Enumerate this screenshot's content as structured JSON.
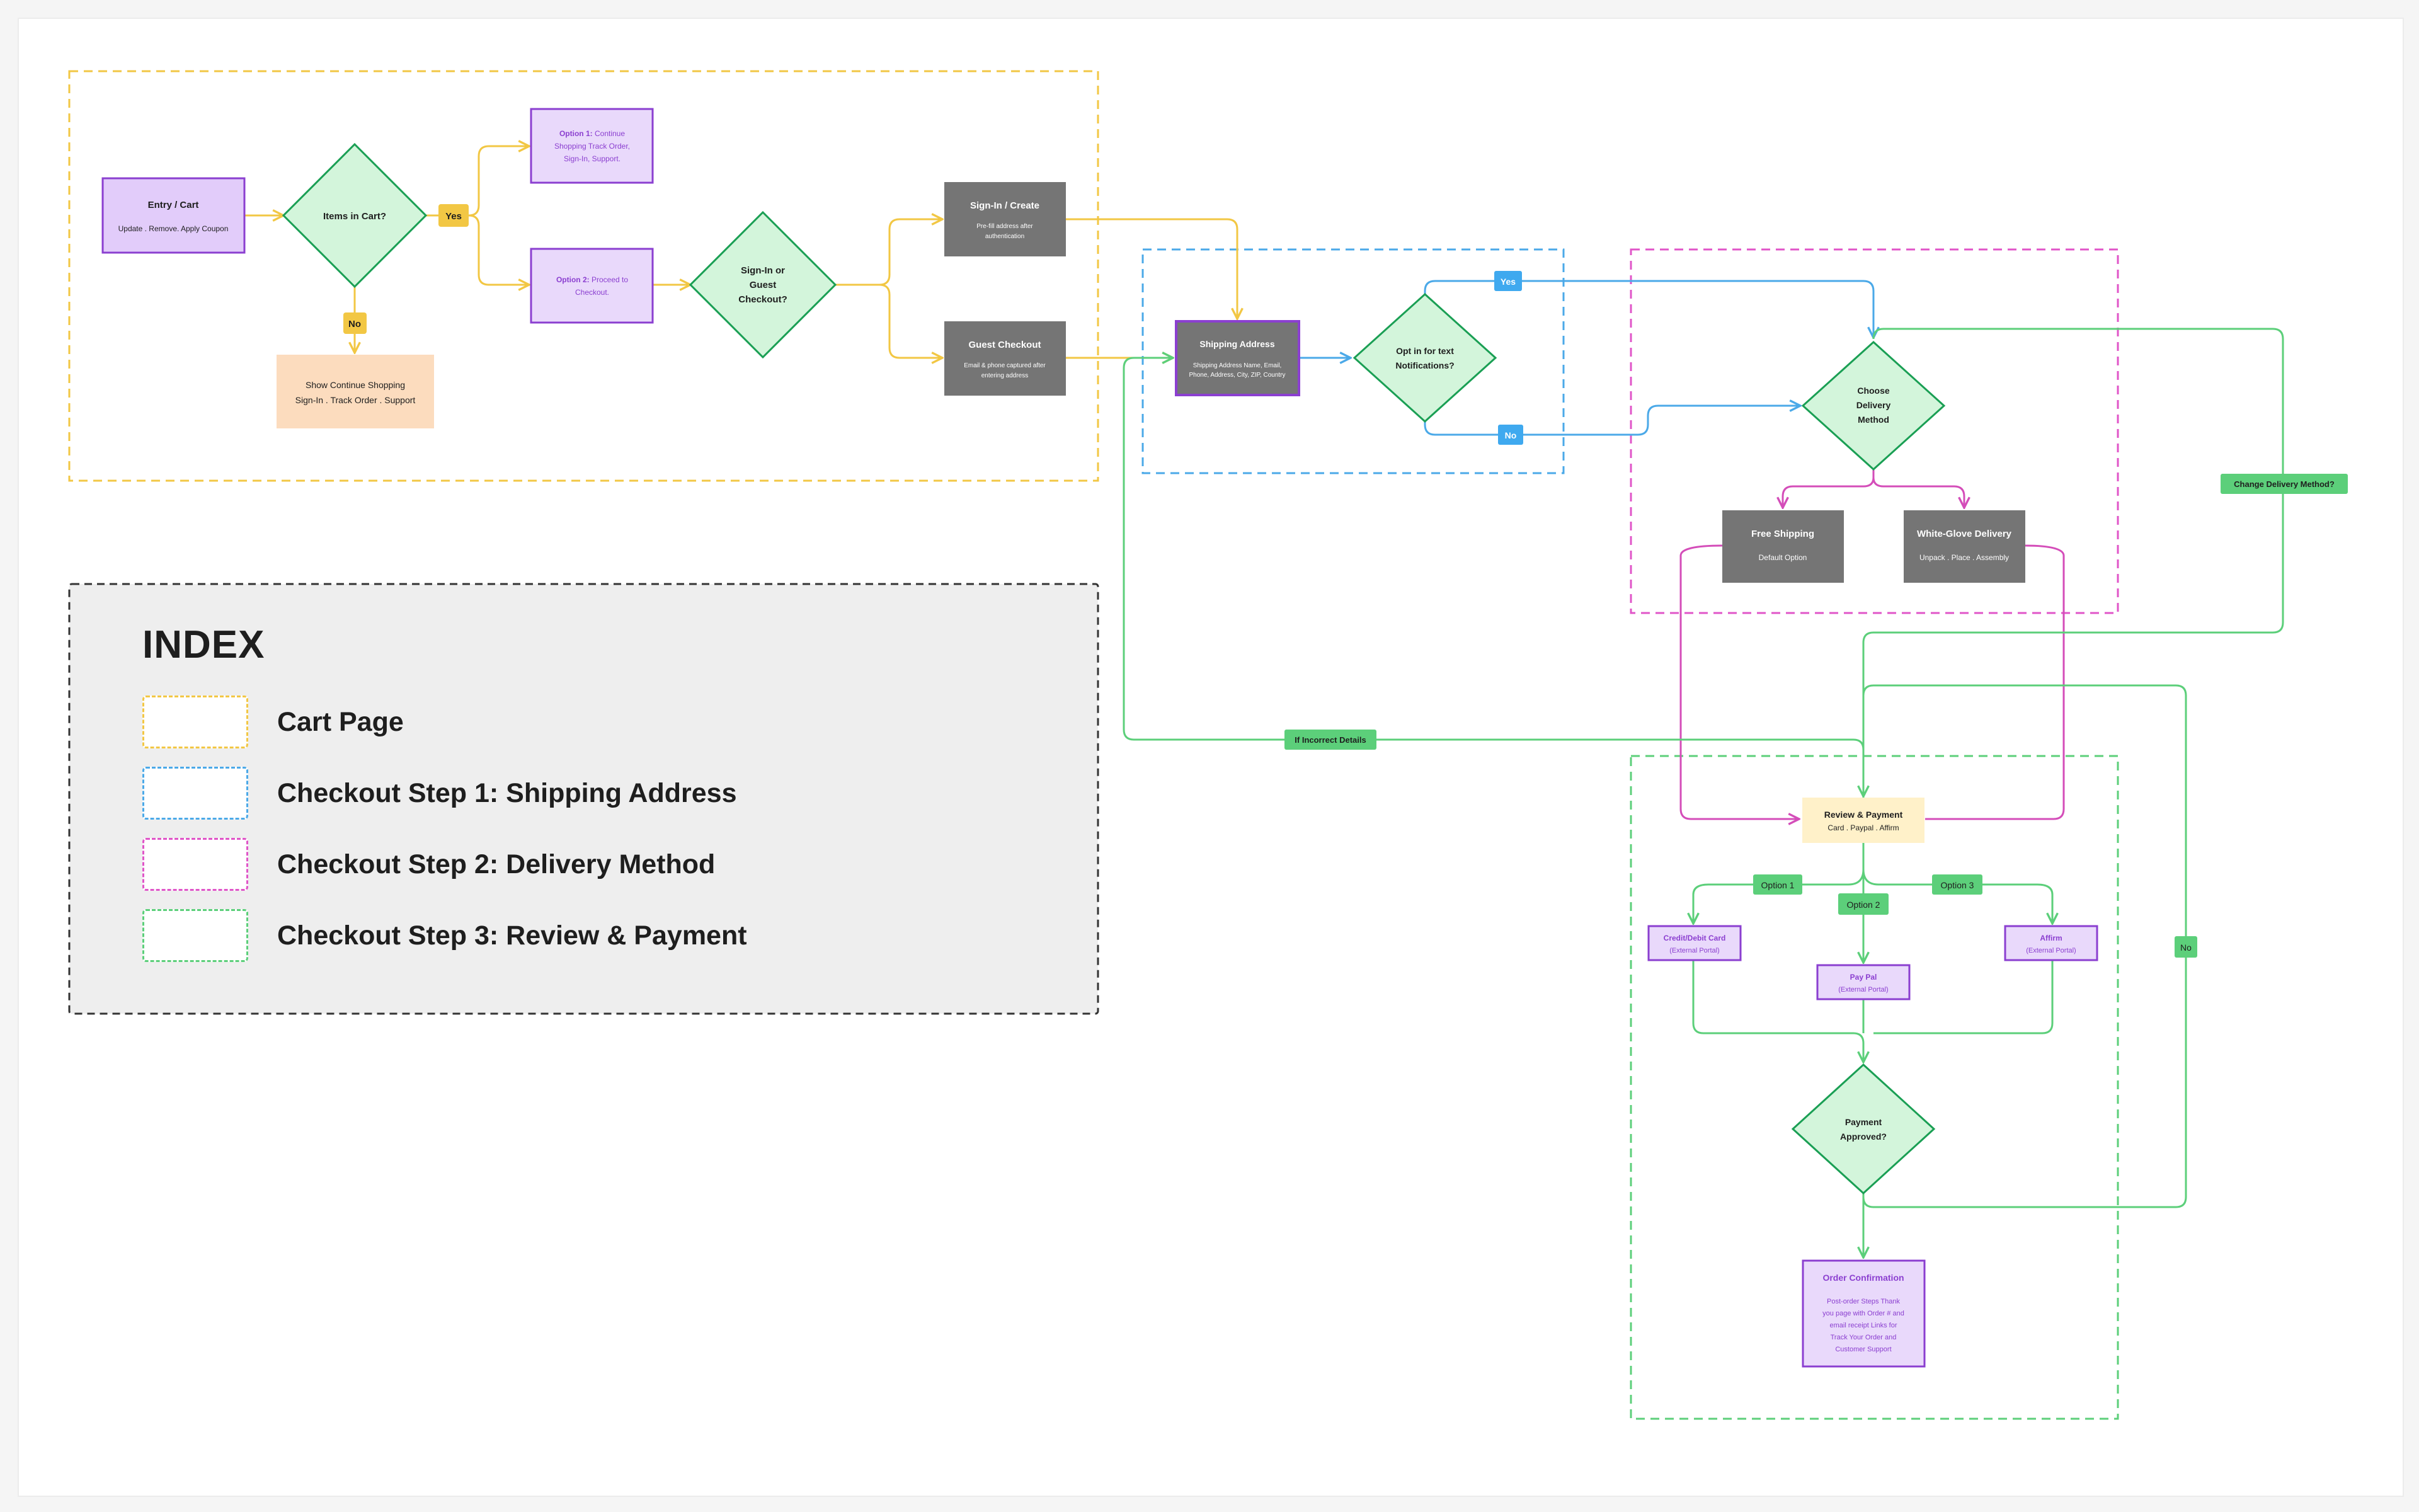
{
  "colors": {
    "cart_page": "#f2c744",
    "shipping": "#4ba9e8",
    "delivery": "#e055c8",
    "payment": "#5ccf7a",
    "purple_fill": "#e2ccfa",
    "purple_border": "#8b3fd0",
    "purple_text": "#8b3fd0",
    "gray_box": "#757575",
    "peach": "#fcdcbe",
    "diamond_fill": "#d3f5db",
    "diamond_stroke": "#1a9f54",
    "label_green": "#5ccf7a",
    "label_blue": "#3fa9ef",
    "label_yellow": "#f2c744",
    "review_fill": "#fff1c9"
  },
  "nodes": {
    "entry_cart": {
      "title": "Entry / Cart",
      "subtitle": "Update . Remove. Apply Coupon"
    },
    "items_in_cart": {
      "line1": "Items in Cart?"
    },
    "option1": {
      "bold": "Option 1:",
      "line1": "Continue",
      "line2": "Shopping Track Order,",
      "line3": "Sign-In, Support."
    },
    "option2": {
      "bold": "Option 2:",
      "line1": "Proceed to",
      "line2": "Checkout."
    },
    "show_continue": {
      "line1": "Show Continue Shopping",
      "line2": "Sign-In . Track Order . Support"
    },
    "signin_or_guest": {
      "line1": "Sign-In or",
      "line2": "Guest",
      "line3": "Checkout?"
    },
    "signin_create": {
      "title": "Sign-In / Create",
      "line1": "Pre-fill address after",
      "line2": "authentication"
    },
    "guest_checkout": {
      "title": "Guest Checkout",
      "line1": "Email & phone captured after",
      "line2": "entering address"
    },
    "shipping_address": {
      "title": "Shipping Address",
      "line1": "Shipping Address Name, Email,",
      "line2": "Phone, Address, City, ZIP, Country"
    },
    "opt_in": {
      "line1": "Opt in for text",
      "line2": "Notifications?"
    },
    "choose_delivery": {
      "line1": "Choose",
      "line2": "Delivery",
      "line3": "Method"
    },
    "free_shipping": {
      "title": "Free Shipping",
      "subtitle": "Default Option"
    },
    "white_glove": {
      "title": "White-Glove Delivery",
      "subtitle": "Unpack . Place . Assembly"
    },
    "review_payment": {
      "title": "Review & Payment",
      "subtitle": "Card . Paypal . Affirm"
    },
    "credit_card": {
      "title": "Credit/Debit Card",
      "subtitle": "(External Portal)"
    },
    "paypal": {
      "title": "Pay Pal",
      "subtitle": "(External Portal)"
    },
    "affirm": {
      "title": "Affirm",
      "subtitle": "(External Portal)"
    },
    "payment_approved": {
      "line1": "Payment",
      "line2": "Approved?"
    },
    "order_confirmation": {
      "title": "Order Confirmation",
      "line1": "Post-order Steps Thank",
      "line2": "you page with Order # and",
      "line3": "email receipt Links for",
      "line4": "Track Your Order and",
      "line5": "Customer Support"
    }
  },
  "labels": {
    "yes_cart": "Yes",
    "no_cart": "No",
    "yes_optin": "Yes",
    "no_optin": "No",
    "change_delivery": "Change Delivery Method?",
    "incorrect_details": "If Incorrect Details",
    "option_1": "Option 1",
    "option_2": "Option 2",
    "option_3": "Option 3",
    "no_payment": "No"
  },
  "index": {
    "title": "INDEX",
    "items": [
      {
        "label": "Cart Page",
        "color": "#f2c744"
      },
      {
        "label": "Checkout Step 1: Shipping Address",
        "color": "#4ba9e8"
      },
      {
        "label": "Checkout Step 2: Delivery Method",
        "color": "#e055c8"
      },
      {
        "label": "Checkout Step 3: Review & Payment",
        "color": "#5ccf7a"
      }
    ]
  }
}
